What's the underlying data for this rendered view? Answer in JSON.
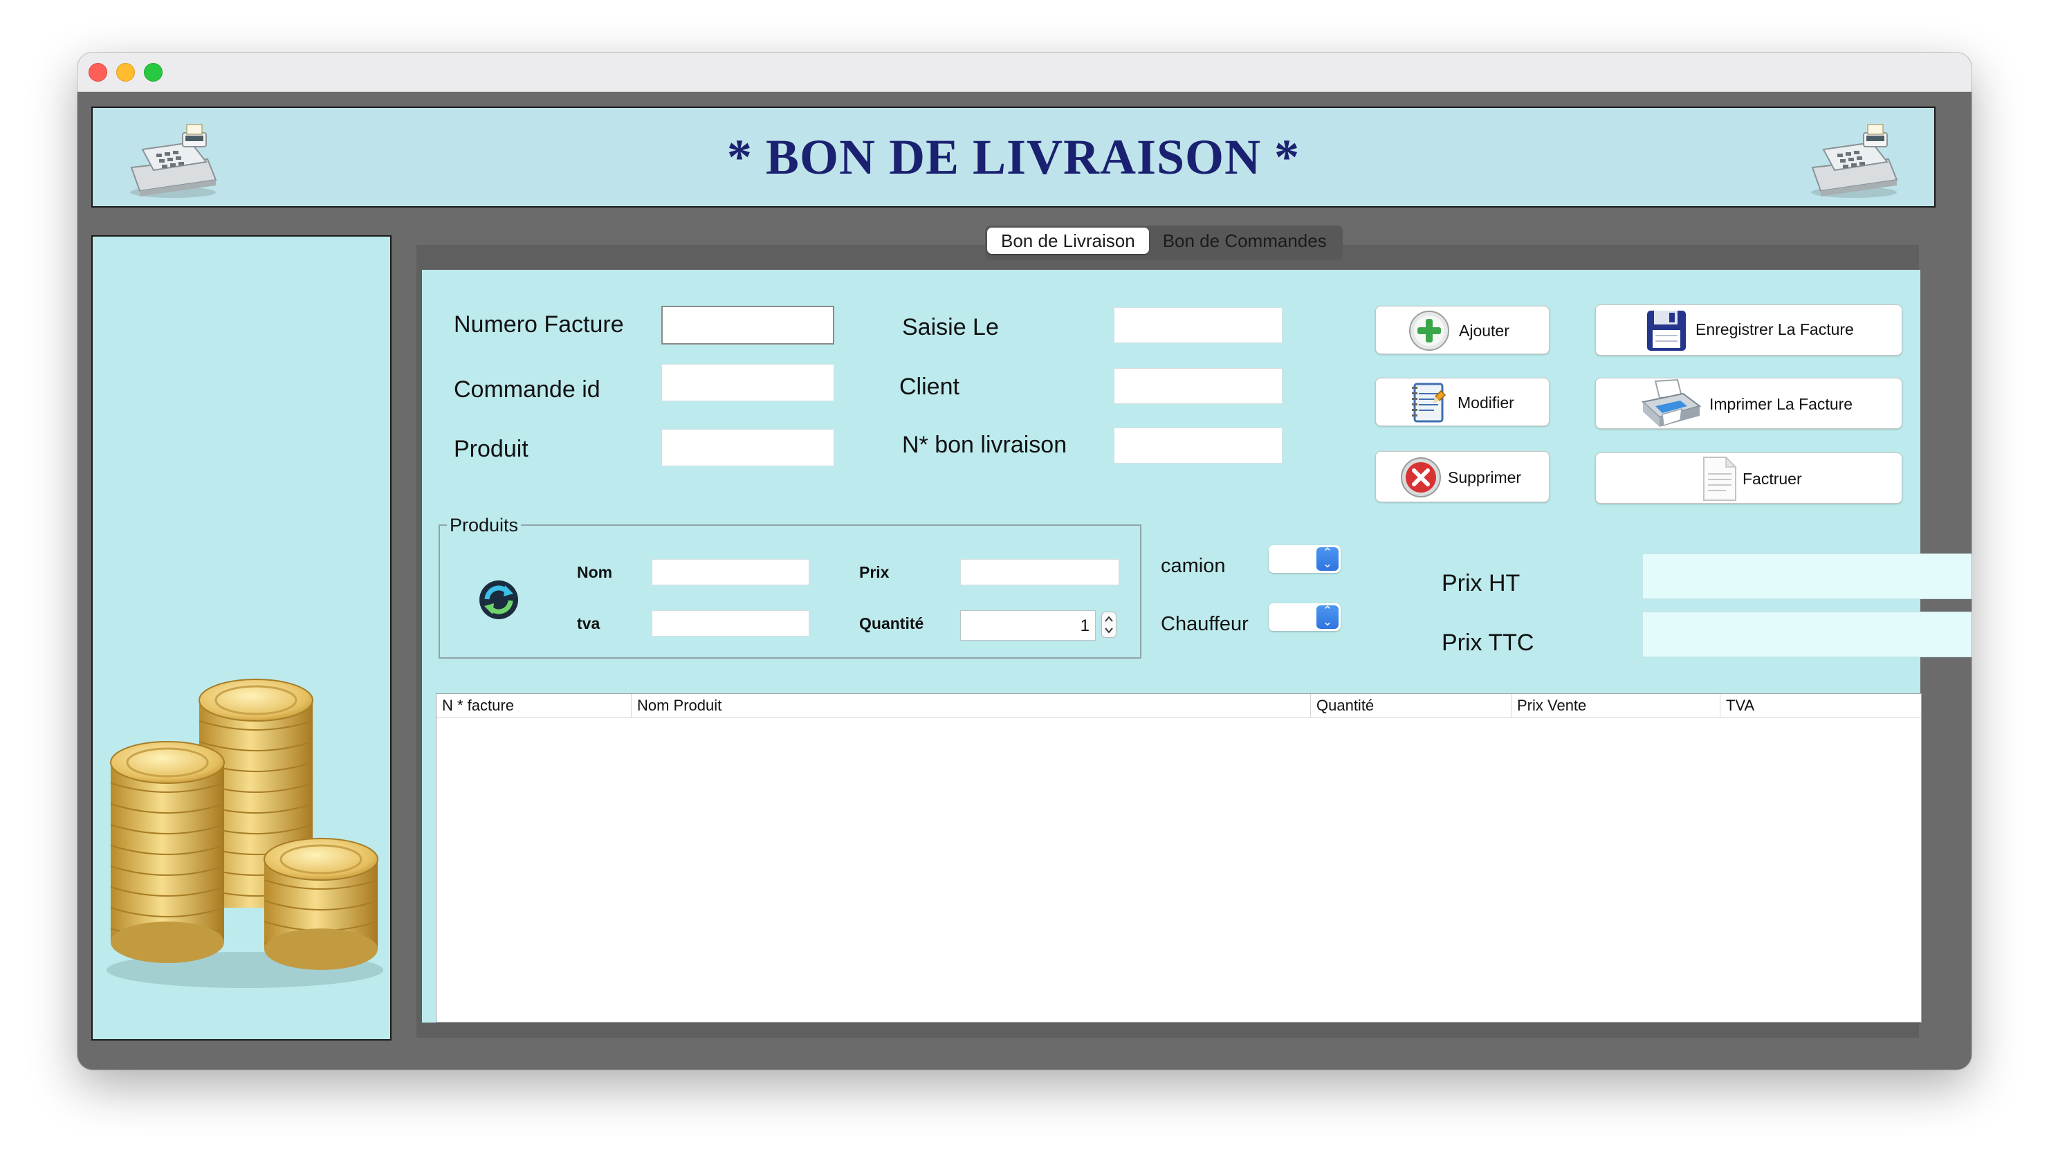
{
  "header": {
    "title": "* BON DE LIVRAISON *"
  },
  "tabs": [
    {
      "label": "Bon de Livraison",
      "active": true
    },
    {
      "label": "Bon de Commandes",
      "active": false
    }
  ],
  "form": {
    "numero_facture_label": "Numero Facture",
    "commande_id_label": "Commande id",
    "produit_label": "Produit",
    "saisie_le_label": "Saisie Le",
    "client_label": "Client",
    "bon_livraison_label": "N* bon livraison"
  },
  "buttons": {
    "ajouter": "Ajouter",
    "modifier": "Modifier",
    "supprimer": "Supprimer",
    "enregistrer": "Enregistrer La Facture",
    "imprimer": "Imprimer La Facture",
    "factruer": "Factruer"
  },
  "produits_group": {
    "title": "Produits",
    "nom_label": "Nom",
    "prix_label": "Prix",
    "tva_label": "tva",
    "quantite_label": "Quantité",
    "quantite_value": "1"
  },
  "transport": {
    "camion_label": "camion",
    "chauffeur_label": "Chauffeur"
  },
  "prices": {
    "prix_ht_label": "Prix HT",
    "prix_ttc_label": "Prix TTC"
  },
  "table": {
    "columns": [
      "N * facture",
      "Nom Produit",
      "Quantité",
      "Prix Vente",
      "TVA"
    ],
    "rows": []
  },
  "icons": {
    "register": "cash-register-icon",
    "coins": "gold-coins-icon",
    "add": "plus-icon",
    "edit": "notepad-icon",
    "delete": "close-icon",
    "save": "floppy-disk-icon",
    "print": "printer-icon",
    "invoice": "document-icon",
    "refresh": "refresh-icon"
  },
  "colors": {
    "panel_bg": "#bdeaec",
    "title_color": "#1a2170",
    "window_bg": "#6b6b6b"
  }
}
